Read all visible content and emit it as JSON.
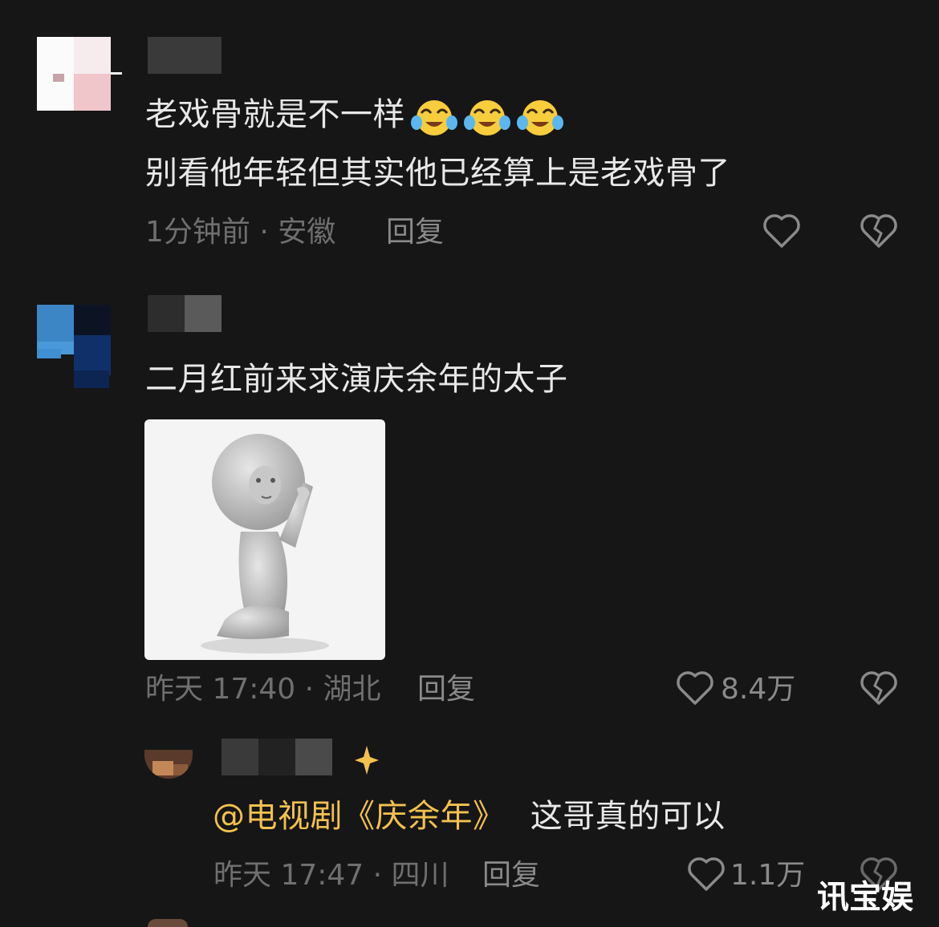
{
  "comments": [
    {
      "text_line1": "老戏骨就是不一样",
      "emojis": [
        "crying-laughing-emoji",
        "crying-laughing-emoji",
        "crying-laughing-emoji"
      ],
      "text_line2": "别看他年轻但其实他已经算上是老戏骨了",
      "meta": "1分钟前 · 安徽",
      "reply": "回复"
    },
    {
      "text": "二月红前来求演庆余年的太子",
      "sticker": "kneeling-praying-figure-sticker",
      "meta": "昨天 17:40 · 湖北",
      "reply": "回复",
      "likes": "8.4万"
    },
    {
      "mention": "@电视剧《庆余年》",
      "text": "这哥真的可以",
      "meta": "昨天 17:47 · 四川",
      "reply": "回复",
      "likes": "1.1万"
    }
  ],
  "watermark": "讯宝娱",
  "colors": {
    "background": "#161616",
    "mention": "#f2c14e",
    "meta": "#6f6f6f"
  }
}
